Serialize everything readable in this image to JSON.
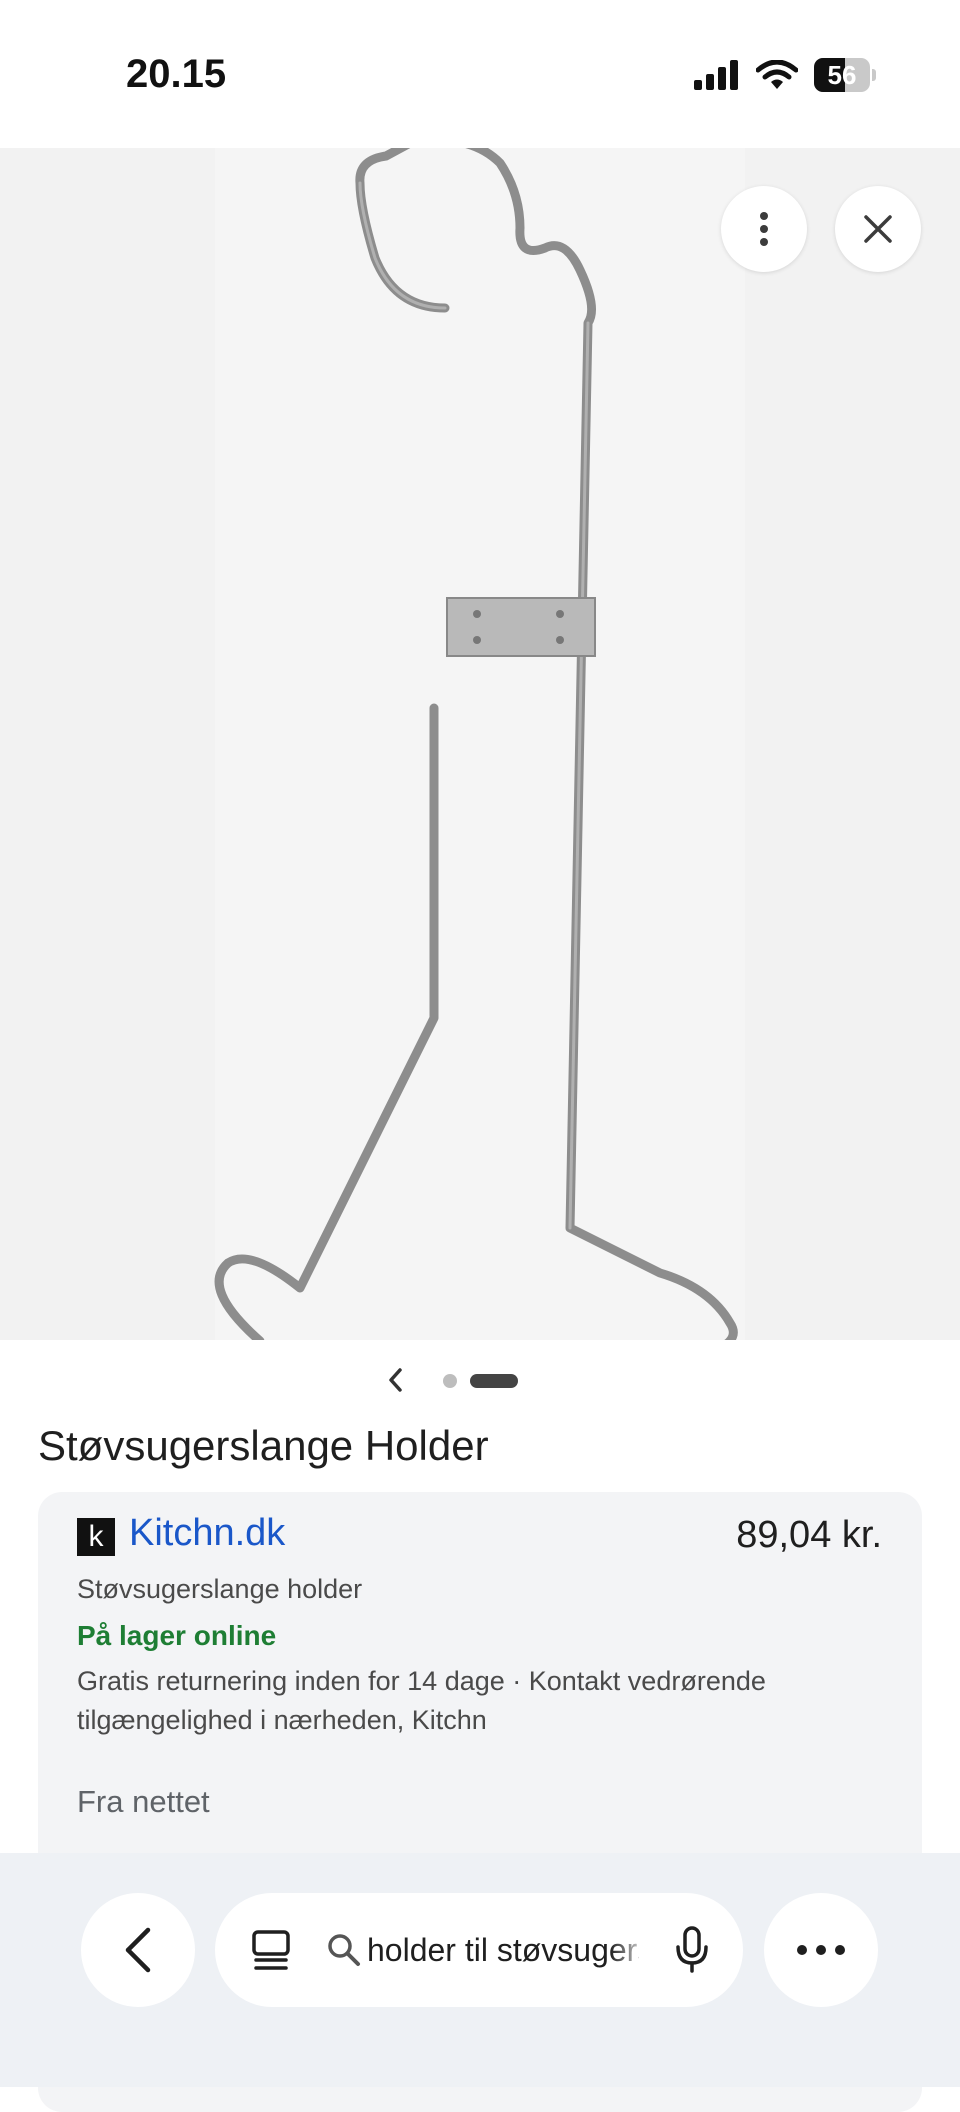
{
  "status_bar": {
    "time": "20.15",
    "battery_level": "56",
    "battery_fraction": 0.56,
    "icons": [
      "signal-icon",
      "wifi-icon",
      "battery-icon"
    ]
  },
  "viewer": {
    "image_subject": "wire vacuum hose holder",
    "more_icon": "more-vertical-icon",
    "close_icon": "close-icon",
    "pager": {
      "total": 2,
      "current": 2
    }
  },
  "product": {
    "title": "Støvsugerslange Holder"
  },
  "offer": {
    "merchant_logo": "k",
    "merchant": "Kitchn.dk",
    "price": "89,04 kr.",
    "product_name": "Støvsugerslange holder",
    "stock": "På lager online",
    "shipping": "Gratis returnering inden for 14 dage · Kontakt vedrørende tilgængelighed i nærheden, Kitchn",
    "section_label": "Fra nettet"
  },
  "bottom_bar": {
    "search_text": "holder til støvsugerslange",
    "icons": [
      "back-icon",
      "tabs-icon",
      "search-icon",
      "mic-icon",
      "more-horizontal-icon"
    ]
  },
  "colors": {
    "link": "#1a57c9",
    "stock": "#1e7e34",
    "card_bg": "#f3f4f6",
    "bottom_bar_bg": "#eef1f5"
  }
}
